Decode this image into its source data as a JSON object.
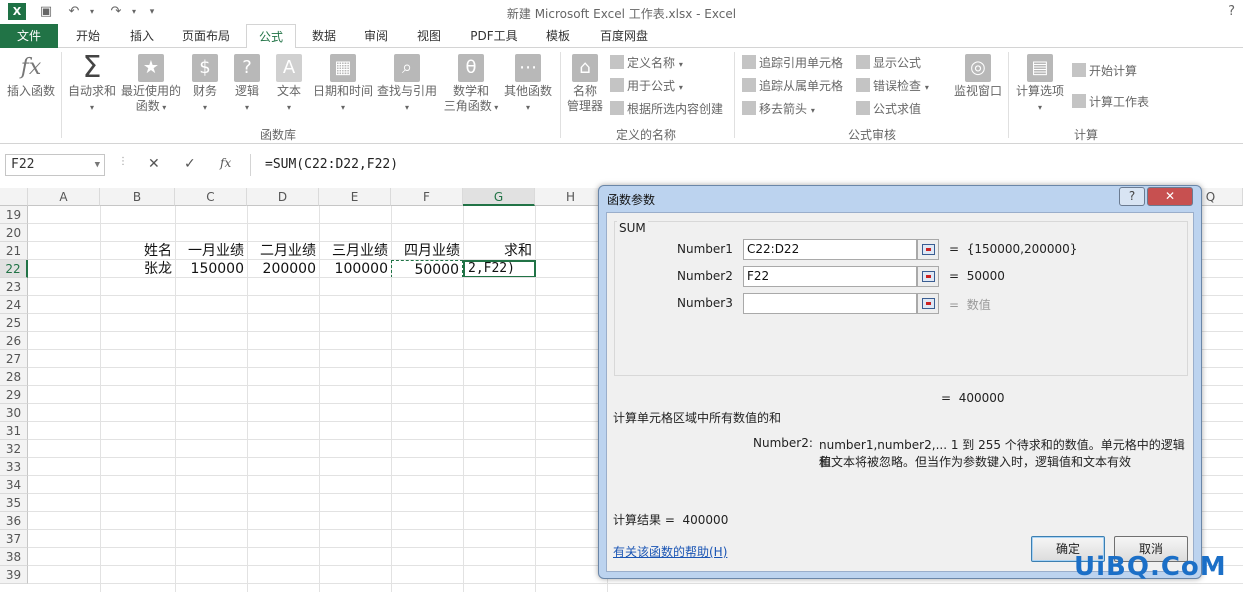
{
  "window": {
    "title": "新建 Microsoft Excel 工作表.xlsx - Excel",
    "help": "?"
  },
  "ribbon_tabs": [
    "文件",
    "开始",
    "插入",
    "页面布局",
    "公式",
    "数据",
    "审阅",
    "视图",
    "PDF工具",
    "模板",
    "百度网盘"
  ],
  "active_tab": "公式",
  "ribbon": {
    "function_library": {
      "insert_function": "插入函数",
      "autosum": "自动求和",
      "recent": [
        "最近使用的",
        "函数"
      ],
      "financial": "财务",
      "logical": "逻辑",
      "text": "文本",
      "datetime": "日期和时间",
      "lookup": "查找与引用",
      "math": [
        "数学和",
        "三角函数"
      ],
      "other": "其他函数",
      "group_label": "函数库"
    },
    "defined_names": {
      "name_manager": [
        "名称",
        "管理器"
      ],
      "define_name": "定义名称",
      "use_in_formula": "用于公式",
      "create_from_selection": "根据所选内容创建",
      "group_label": "定义的名称"
    },
    "formula_auditing": {
      "trace_precedents": "追踪引用单元格",
      "trace_dependents": "追踪从属单元格",
      "remove_arrows": "移去箭头",
      "show_formulas": "显示公式",
      "error_checking": "错误检查",
      "evaluate_formula": "公式求值",
      "watch_window": "监视窗口",
      "group_label": "公式审核"
    },
    "calculation": {
      "calc_options": "计算选项",
      "calc_now": "开始计算",
      "calc_sheet": "计算工作表",
      "group_label": "计算"
    }
  },
  "formula_bar": {
    "name_box": "F22",
    "formula": "=SUM(C22:D22,F22)"
  },
  "sheet": {
    "columns": [
      "A",
      "B",
      "C",
      "D",
      "E",
      "F",
      "G",
      "H",
      "Q"
    ],
    "selected_column": "G",
    "rows": [
      "19",
      "20",
      "21",
      "22",
      "23",
      "24",
      "25",
      "26",
      "27",
      "28",
      "29",
      "30",
      "31",
      "32",
      "33",
      "34",
      "35",
      "36",
      "37",
      "38",
      "39"
    ],
    "selected_row": "22",
    "header_row": [
      "姓名",
      "一月业绩",
      "二月业绩",
      "三月业绩",
      "四月业绩",
      "求和"
    ],
    "data_row": [
      "张龙",
      "150000",
      "200000",
      "100000",
      "50000",
      "2,F22)"
    ]
  },
  "dialog": {
    "title": "函数参数",
    "function": "SUM",
    "args": [
      {
        "label": "Number1",
        "value": "C22:D22",
        "result": "{150000,200000}"
      },
      {
        "label": "Number2",
        "value": "F22",
        "result": "50000"
      },
      {
        "label": "Number3",
        "value": "",
        "result": "数值"
      }
    ],
    "equals": "=",
    "total": "400000",
    "description": "计算单元格区域中所有数值的和",
    "arg_name": "Number2:",
    "arg_help_1": "number1,number2,...  1 到 255 个待求和的数值。单元格中的逻辑值",
    "arg_help_2": "和文本将被忽略。但当作为参数键入时，逻辑值和文本有效",
    "result_label": "计算结果 =",
    "result_value": "400000",
    "help_link": "有关该函数的帮助(H)",
    "ok": "确定",
    "cancel": "取消"
  },
  "watermark": "UiBQ.CoM"
}
